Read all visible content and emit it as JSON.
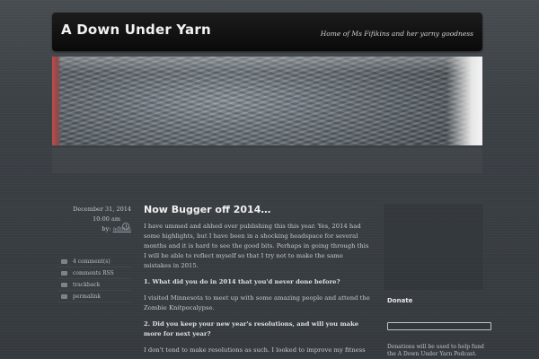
{
  "header": {
    "site_title": "A Down Under Yarn",
    "tagline": "Home of Ms Fifikins and her yarny goodness"
  },
  "meta": {
    "date": "December 31, 2014",
    "time": "10:00 am",
    "by_label": "by:",
    "author": "admin"
  },
  "actions": [
    {
      "label": "4 comment(s)",
      "icon": "comment-icon"
    },
    {
      "label": "comments RSS",
      "icon": "rss-icon"
    },
    {
      "label": "trackback",
      "icon": "trackback-icon"
    },
    {
      "label": "permalink",
      "icon": "link-icon"
    }
  ],
  "post": {
    "title": "Now Bugger off 2014…",
    "paragraphs": [
      "I have ummed and ahhed over publishing this this year. Yes, 2014 had some highlights, but I have been in a shocking headspace for several months and it is hard to see the good bits. Perhaps in going through this I will be able to reflect myself so that I try not to make the same mistakes in 2015.",
      "1. What did you do in 2014 that you'd never done before?",
      "I visited Minnesota to meet up with some amazing people and attend the Zombie Knitpocalypse.",
      "2. Did you keep your new year's resolutions, and will you make more for next year?",
      "I don't tend to make resolutions as such. I looked to improve my fitness"
    ]
  },
  "sidebar": {
    "donate_title": "Donate",
    "donate_text": "Donations will be used to help fund the A Down Under Yarn Podcast."
  }
}
